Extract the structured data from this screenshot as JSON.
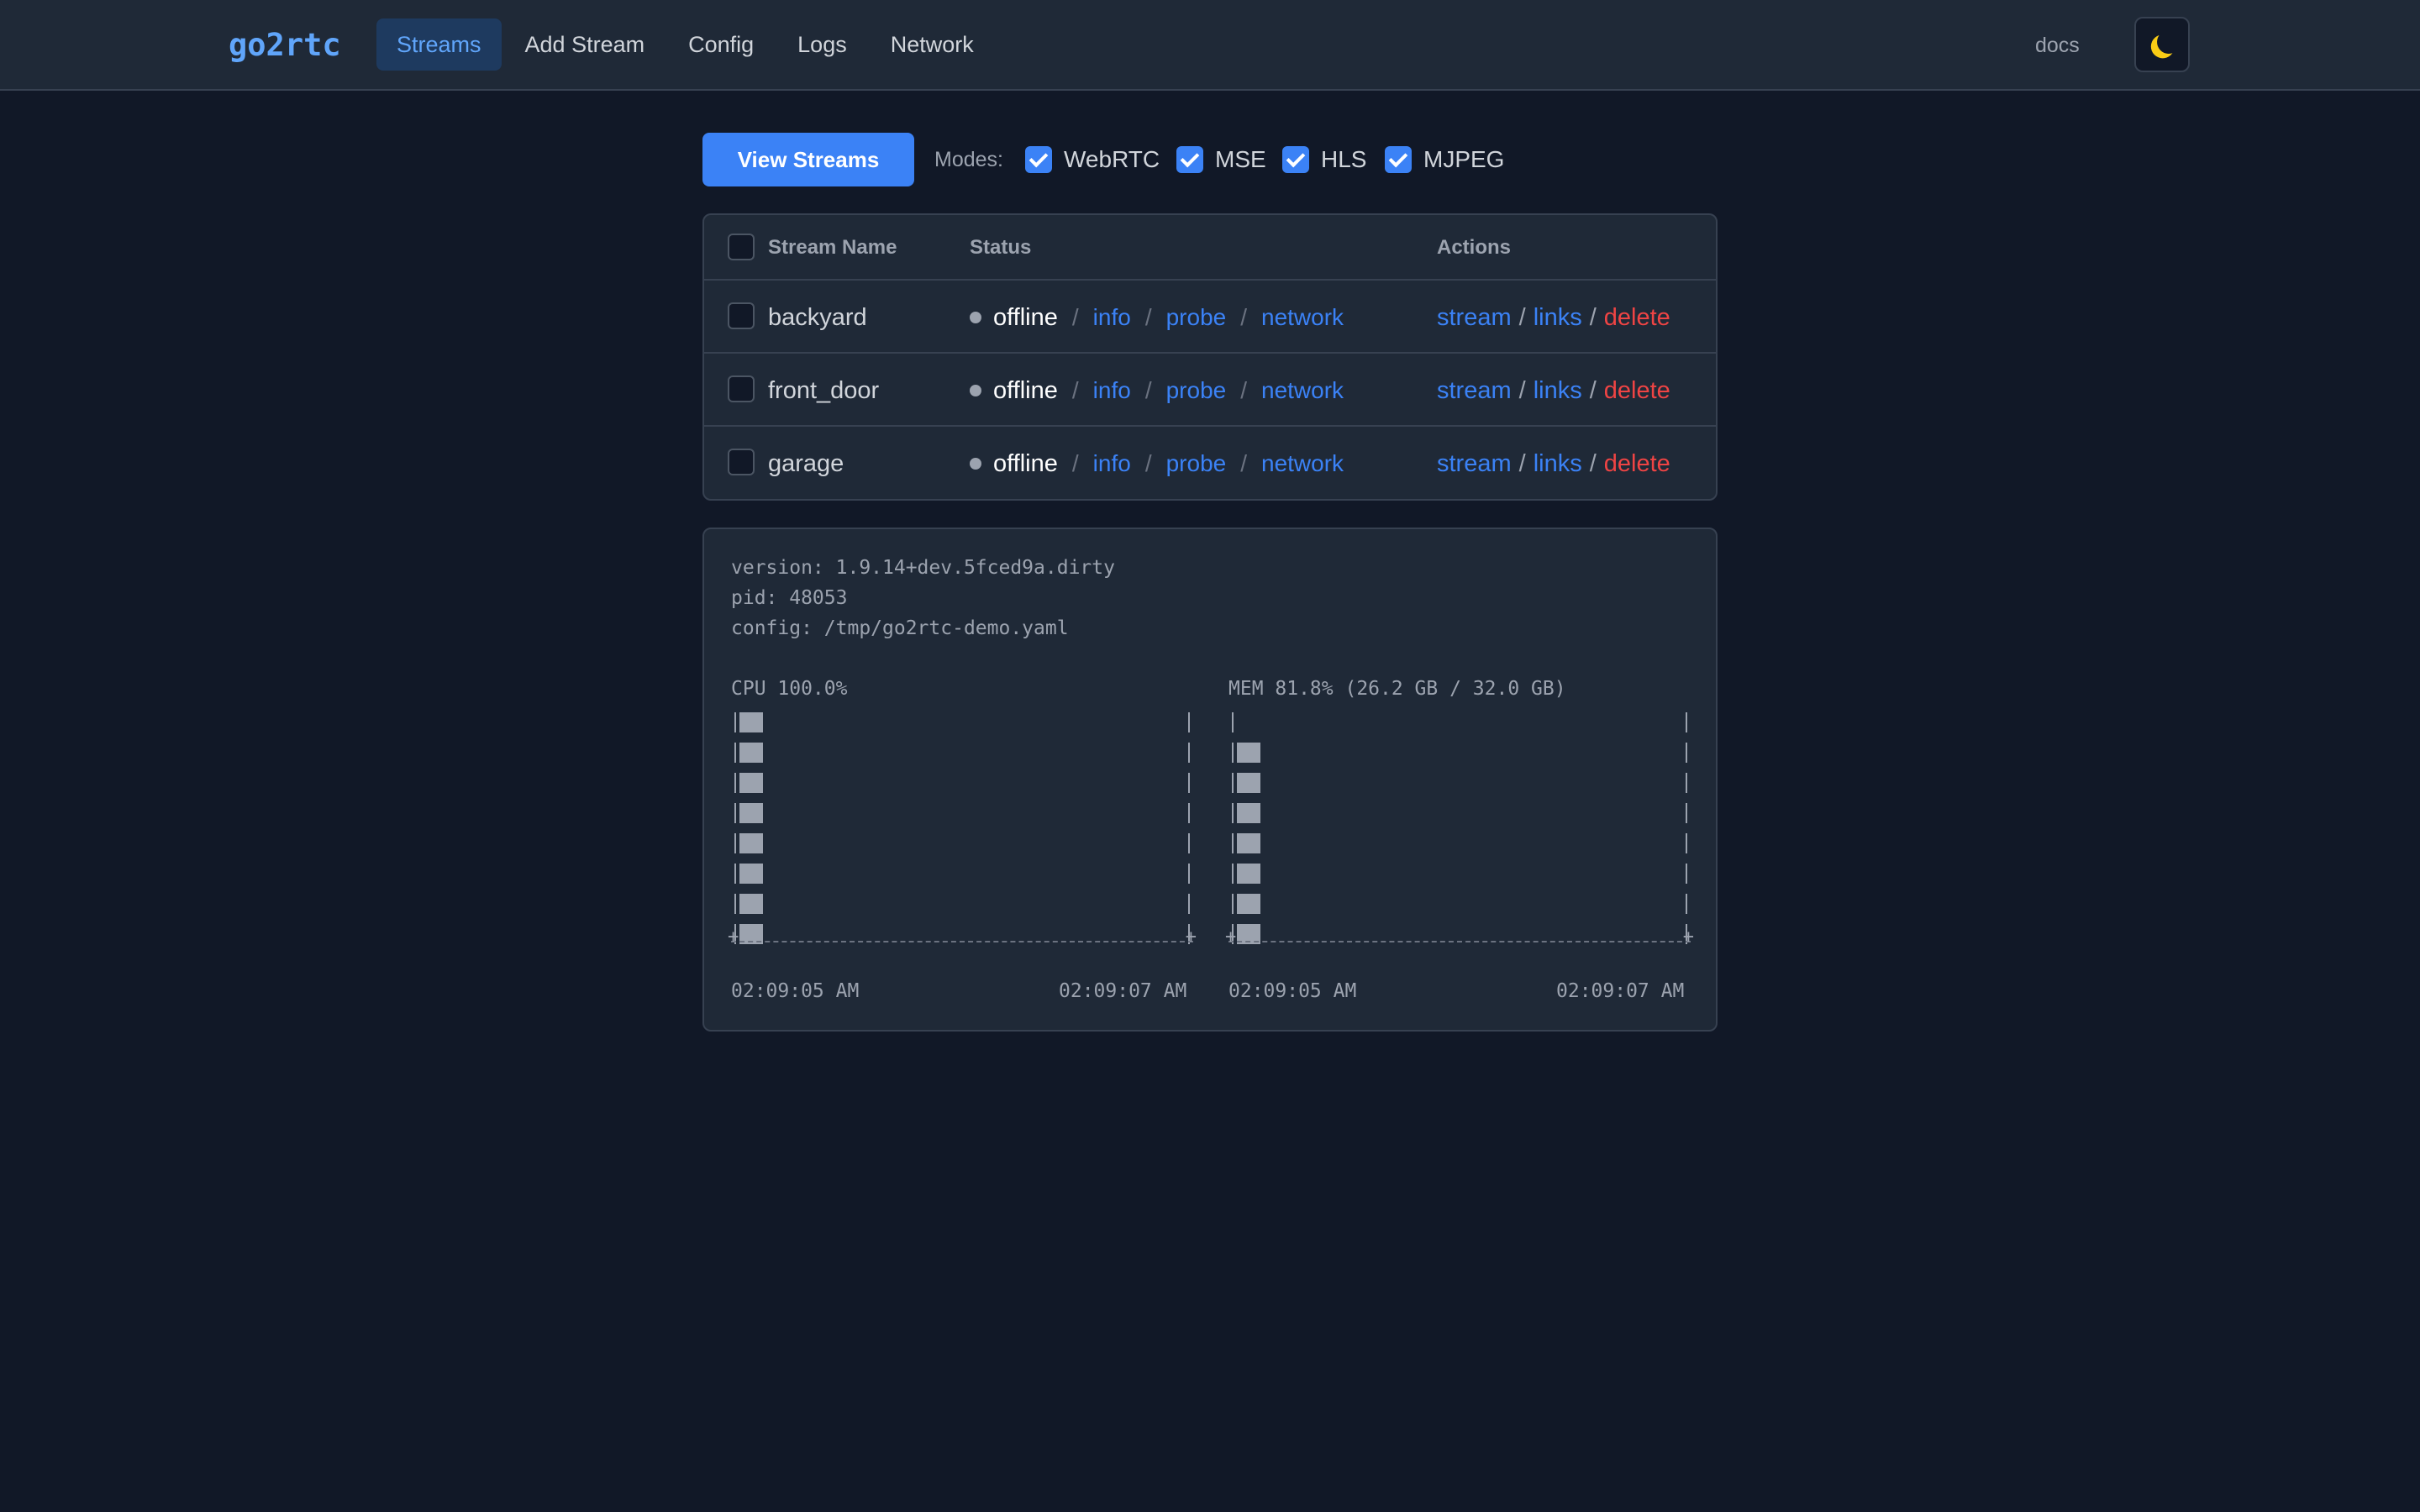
{
  "app": {
    "logo": "go2rtc"
  },
  "nav": {
    "items": [
      {
        "label": "Streams",
        "active": true
      },
      {
        "label": "Add Stream",
        "active": false
      },
      {
        "label": "Config",
        "active": false
      },
      {
        "label": "Logs",
        "active": false
      },
      {
        "label": "Network",
        "active": false
      }
    ],
    "docs_label": "docs",
    "theme_icon": "moon-icon"
  },
  "toolbar": {
    "view_streams_label": "View Streams",
    "modes_label": "Modes:",
    "modes": [
      {
        "label": "WebRTC",
        "checked": true
      },
      {
        "label": "MSE",
        "checked": true
      },
      {
        "label": "HLS",
        "checked": true
      },
      {
        "label": "MJPEG",
        "checked": true
      }
    ]
  },
  "table": {
    "headers": {
      "name": "Stream Name",
      "status": "Status",
      "actions": "Actions"
    },
    "rows": [
      {
        "name": "backyard",
        "status": "offline",
        "links": [
          "info",
          "probe",
          "network"
        ],
        "actions": [
          "stream",
          "links",
          "delete"
        ]
      },
      {
        "name": "front_door",
        "status": "offline",
        "links": [
          "info",
          "probe",
          "network"
        ],
        "actions": [
          "stream",
          "links",
          "delete"
        ]
      },
      {
        "name": "garage",
        "status": "offline",
        "links": [
          "info",
          "probe",
          "network"
        ],
        "actions": [
          "stream",
          "links",
          "delete"
        ]
      }
    ]
  },
  "info": {
    "version": "version: 1.9.14+dev.5fced9a.dirty",
    "pid": "pid: 48053",
    "config": "config: /tmp/go2rtc-demo.yaml",
    "cpu": {
      "title": "CPU 100.0%",
      "rows": [
        1,
        1,
        1,
        1,
        1,
        1,
        1,
        1
      ],
      "time_start": "02:09:05 AM",
      "time_end": "02:09:07 AM"
    },
    "mem": {
      "title": "MEM 81.8% (26.2 GB / 32.0 GB)",
      "rows": [
        0,
        1,
        1,
        1,
        1,
        1,
        1,
        1
      ],
      "time_start": "02:09:05 AM",
      "time_end": "02:09:07 AM"
    }
  }
}
